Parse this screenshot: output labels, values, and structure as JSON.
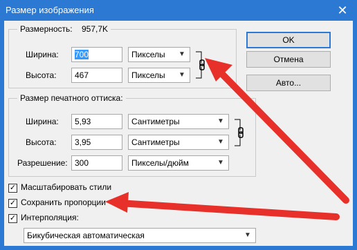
{
  "title": "Размер изображения",
  "pixel": {
    "title_prefix": "Размерность:",
    "dim": "957,7K",
    "width_label": "Ширина:",
    "width_value": "700",
    "width_unit": "Пикселы",
    "height_label": "Высота:",
    "height_value": "467",
    "height_unit": "Пикселы"
  },
  "print": {
    "legend": "Размер печатного оттиска:",
    "width_label": "Ширина:",
    "width_value": "5,93",
    "width_unit": "Сантиметры",
    "height_label": "Высота:",
    "height_value": "3,95",
    "height_unit": "Сантиметры",
    "res_label": "Разрешение:",
    "res_value": "300",
    "res_unit": "Пикселы/дюйм"
  },
  "buttons": {
    "ok": "OK",
    "cancel": "Отмена",
    "auto": "Авто..."
  },
  "options": {
    "scale_styles": "Масштабировать стили",
    "constrain": "Сохранить пропорции",
    "resample": "Интерполяция:",
    "resample_method": "Бикубическая автоматическая"
  },
  "colors": {
    "titlebar": "#2b79d3",
    "annotation": "#e8302a"
  },
  "icons": [
    "close-icon",
    "chain-link-icon",
    "dropdown-arrow-icon"
  ]
}
